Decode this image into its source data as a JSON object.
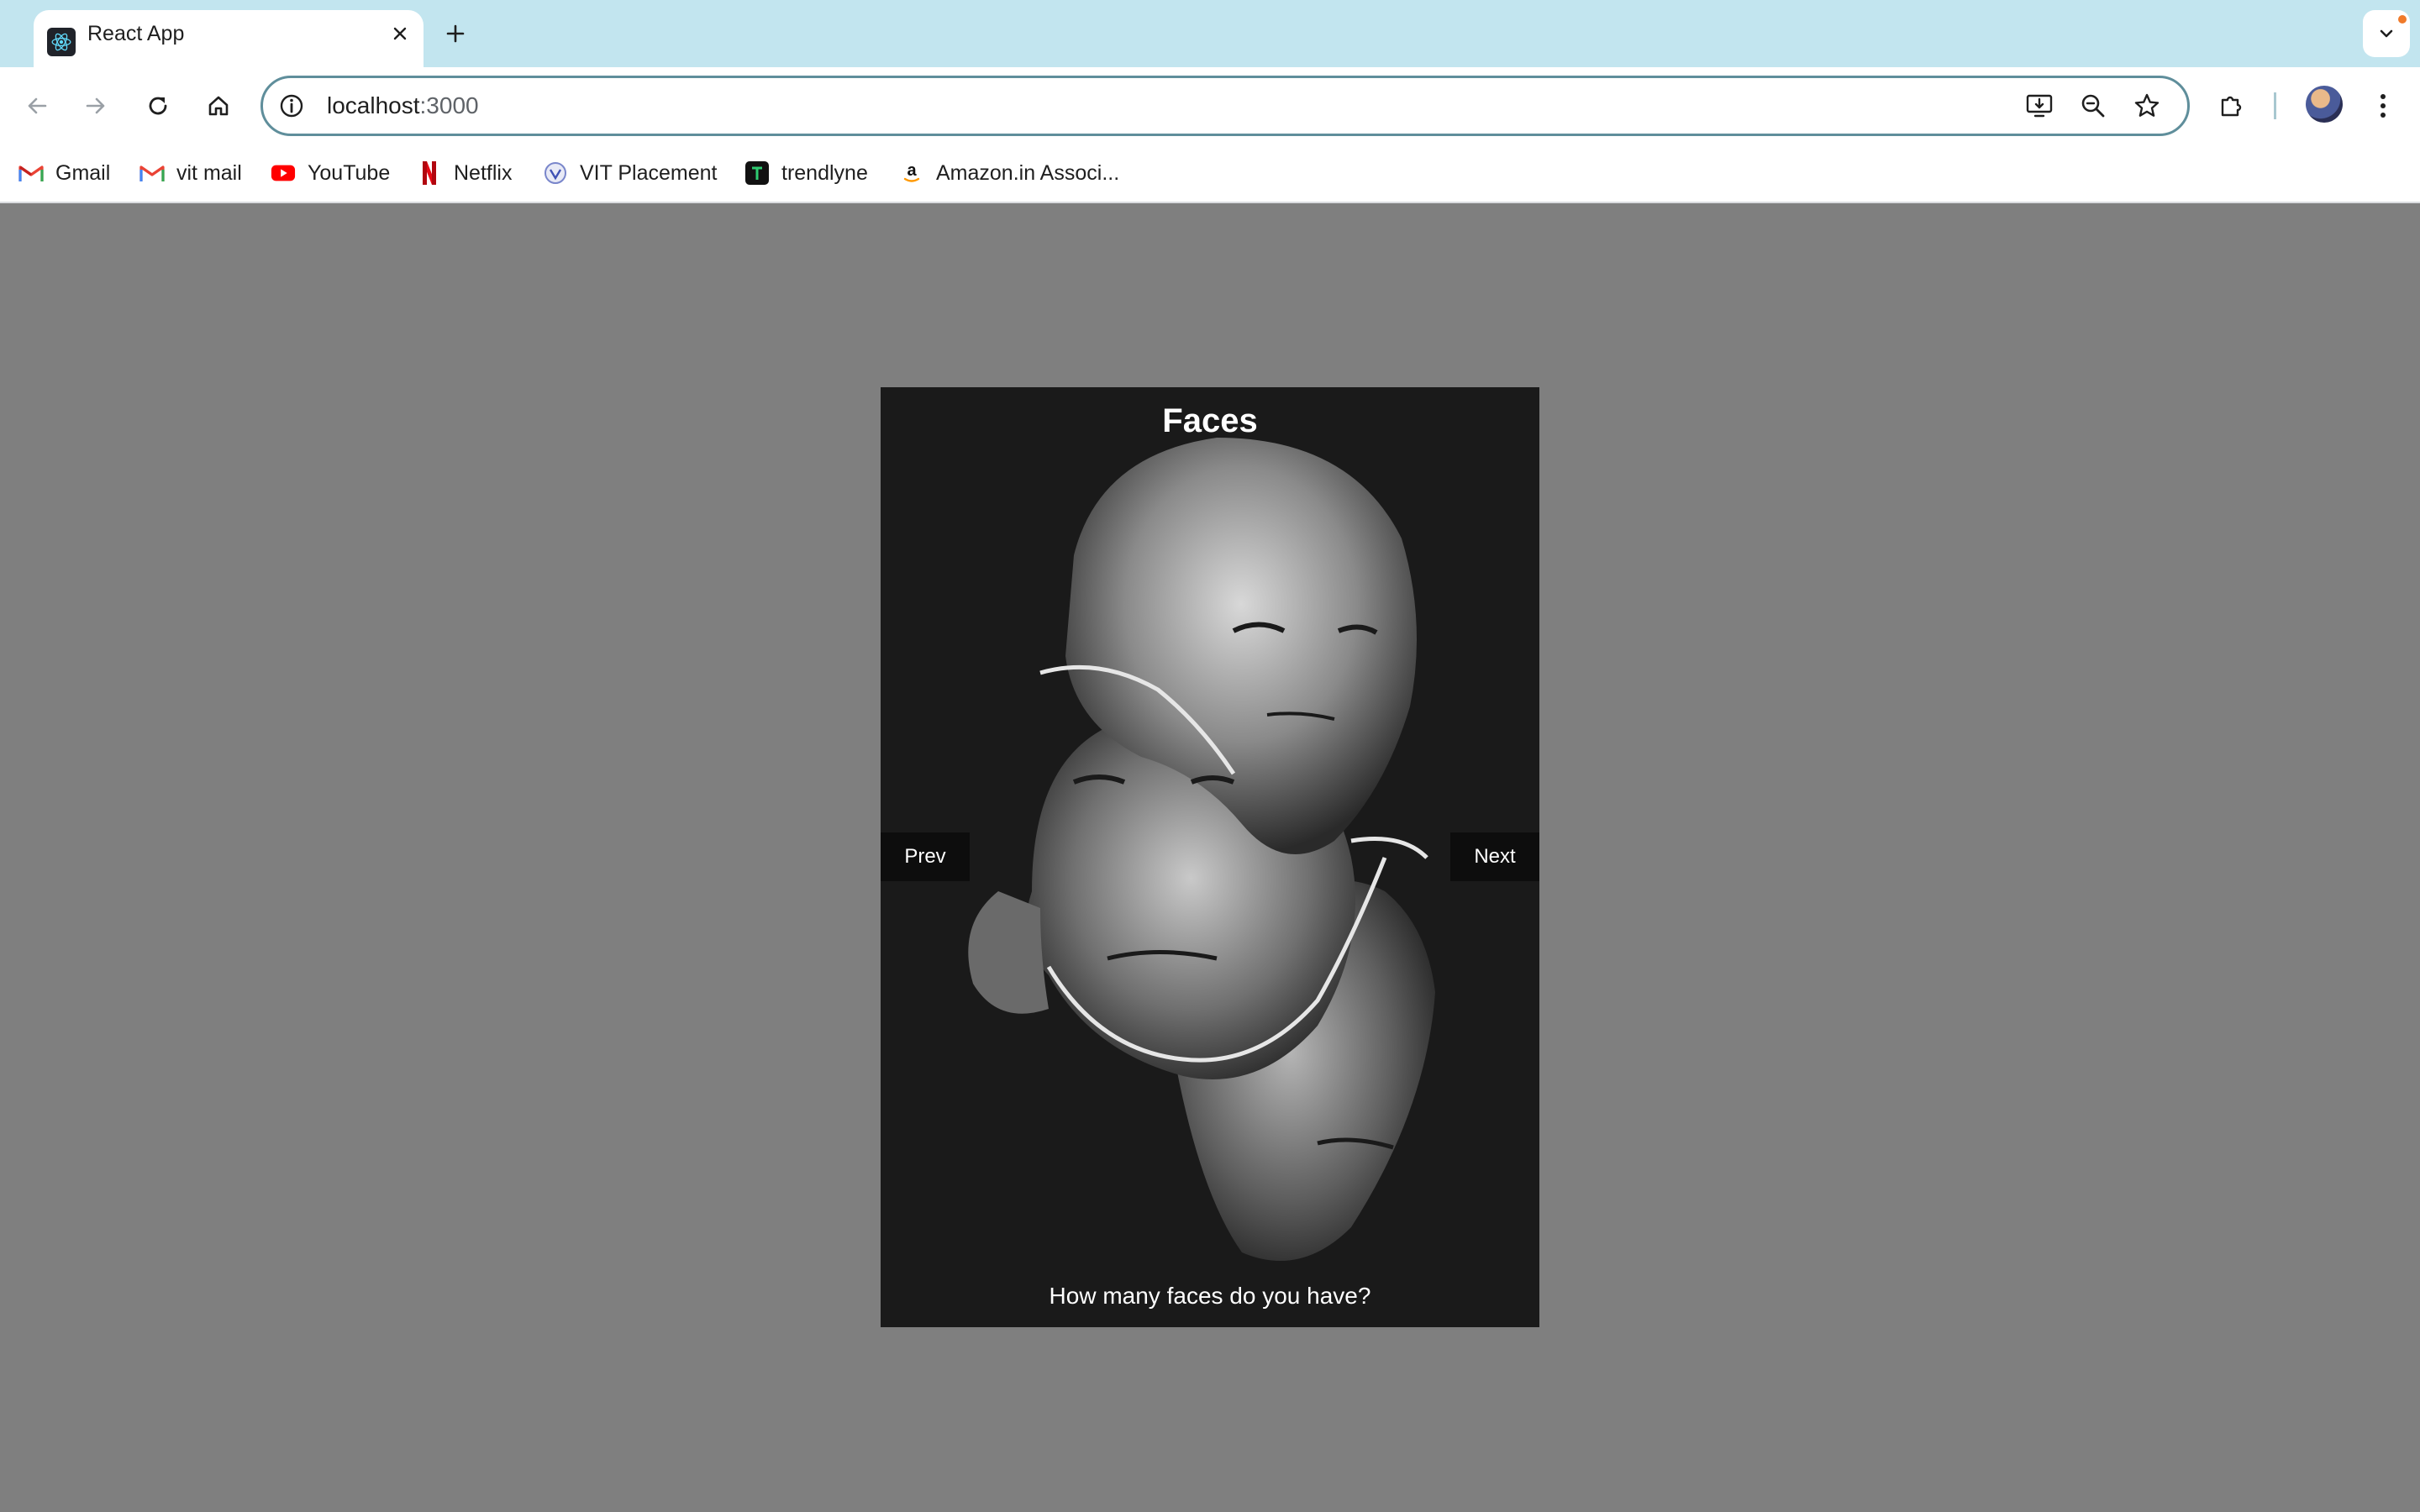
{
  "browser": {
    "tab": {
      "title": "React App",
      "favicon": "react-logo-icon"
    },
    "address_bar": {
      "host": "localhost",
      "port": ":3000"
    },
    "bookmarks": [
      {
        "label": "Gmail",
        "icon": "gmail-icon"
      },
      {
        "label": "vit mail",
        "icon": "gmail-icon"
      },
      {
        "label": "YouTube",
        "icon": "youtube-icon"
      },
      {
        "label": "Netflix",
        "icon": "netflix-icon"
      },
      {
        "label": "VIT Placement",
        "icon": "vit-icon"
      },
      {
        "label": "trendlyne",
        "icon": "trendlyne-icon"
      },
      {
        "label": "Amazon.in Associ...",
        "icon": "amazon-icon"
      }
    ]
  },
  "app": {
    "title": "Faces",
    "caption": "How many faces do you have?",
    "prev_label": "Prev",
    "next_label": "Next"
  },
  "colors": {
    "page_background": "#7f7f7f",
    "card_background": "#1a1a1a",
    "tabstrip": "#c2e5ef"
  }
}
